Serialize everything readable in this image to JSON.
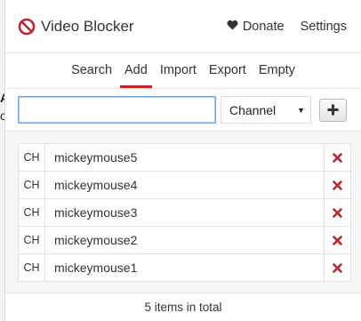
{
  "app": {
    "title": "Video Blocker"
  },
  "header": {
    "donate_label": "Donate",
    "settings_label": "Settings"
  },
  "tabs": [
    {
      "label": "Search",
      "active": false
    },
    {
      "label": "Add",
      "active": true
    },
    {
      "label": "Import",
      "active": false
    },
    {
      "label": "Export",
      "active": false
    },
    {
      "label": "Empty",
      "active": false
    }
  ],
  "add_form": {
    "input_value": "",
    "input_placeholder": "",
    "type_select": {
      "selected": "Channel"
    },
    "add_icon": "plus-icon"
  },
  "items": [
    {
      "type": "CH",
      "name": "mickeymouse5",
      "delete_icon": "close-icon"
    },
    {
      "type": "CH",
      "name": "mickeymouse4",
      "delete_icon": "close-icon"
    },
    {
      "type": "CH",
      "name": "mickeymouse3",
      "delete_icon": "close-icon"
    },
    {
      "type": "CH",
      "name": "mickeymouse2",
      "delete_icon": "close-icon"
    },
    {
      "type": "CH",
      "name": "mickeymouse1",
      "delete_icon": "close-icon"
    }
  ],
  "footer": {
    "total_label": "5 items in total"
  },
  "colors": {
    "accent": "#c2252a",
    "input_focus": "#7aa7e0"
  }
}
